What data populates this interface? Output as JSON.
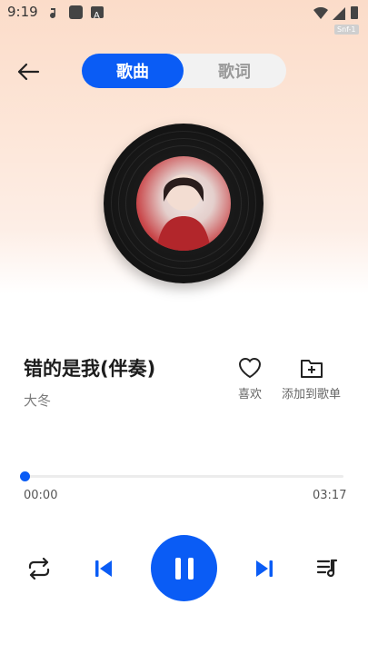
{
  "status_bar": {
    "time": "9:19",
    "badge": "Snf-1"
  },
  "header": {
    "tabs": [
      {
        "label": "歌曲",
        "active": true
      },
      {
        "label": "歌词",
        "active": false
      }
    ]
  },
  "song": {
    "title": "错的是我(伴奏)",
    "artist": "大冬"
  },
  "actions": {
    "like_label": "喜欢",
    "add_label": "添加到歌单"
  },
  "progress": {
    "current": "00:00",
    "total": "03:17",
    "fraction": 0.0
  },
  "colors": {
    "accent": "#0a5cf5"
  },
  "icons": [
    "back-arrow-icon",
    "heart-icon",
    "add-folder-icon",
    "repeat-icon",
    "previous-icon",
    "pause-icon",
    "next-icon",
    "playlist-icon"
  ]
}
